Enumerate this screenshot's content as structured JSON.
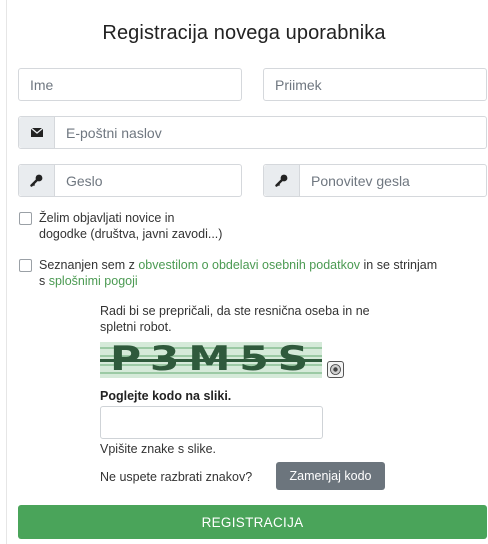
{
  "form": {
    "title": "Registracija novega uporabnika",
    "first_name": {
      "placeholder": "Ime"
    },
    "last_name": {
      "placeholder": "Priimek"
    },
    "email": {
      "placeholder": "E-poštni naslov",
      "icon": "envelope-icon"
    },
    "password": {
      "placeholder": "Geslo",
      "icon": "key-icon"
    },
    "password_repeat": {
      "placeholder": "Ponovitev gesla",
      "icon": "key-icon"
    },
    "newsletter": {
      "checked": false,
      "line1": "Želim objavljati novice in",
      "line2": "dogodke (društva, javni zavodi...)"
    },
    "terms": {
      "checked": false,
      "prefix": "Seznanjen sem z ",
      "privacy_link": "obvestilom o obdelavi osebnih podatkov",
      "middle": " in se strinjam",
      "s": "s ",
      "terms_link": "splošnimi pogoji"
    },
    "captcha": {
      "intro_line1": "Radi bi se prepričali, da ste resnična oseba in ne",
      "intro_line2": "spletni robot.",
      "image_text": "P3M5S",
      "audio_icon": "audio-icon",
      "prompt": "Poglejte kodo na sliki.",
      "input_value": "",
      "hint": "Vpišite znake s slike.",
      "cant_read": "Ne uspete razbrati znakov?",
      "swap_button": "Zamenjaj kodo"
    },
    "submit_label": "REGISTRACIJA"
  },
  "colors": {
    "accent_green": "#4aa45a",
    "link_green": "#4b9a52",
    "secondary_button": "#6c757d",
    "input_border": "#d5d8dc",
    "addon_bg": "#e9ecef"
  }
}
